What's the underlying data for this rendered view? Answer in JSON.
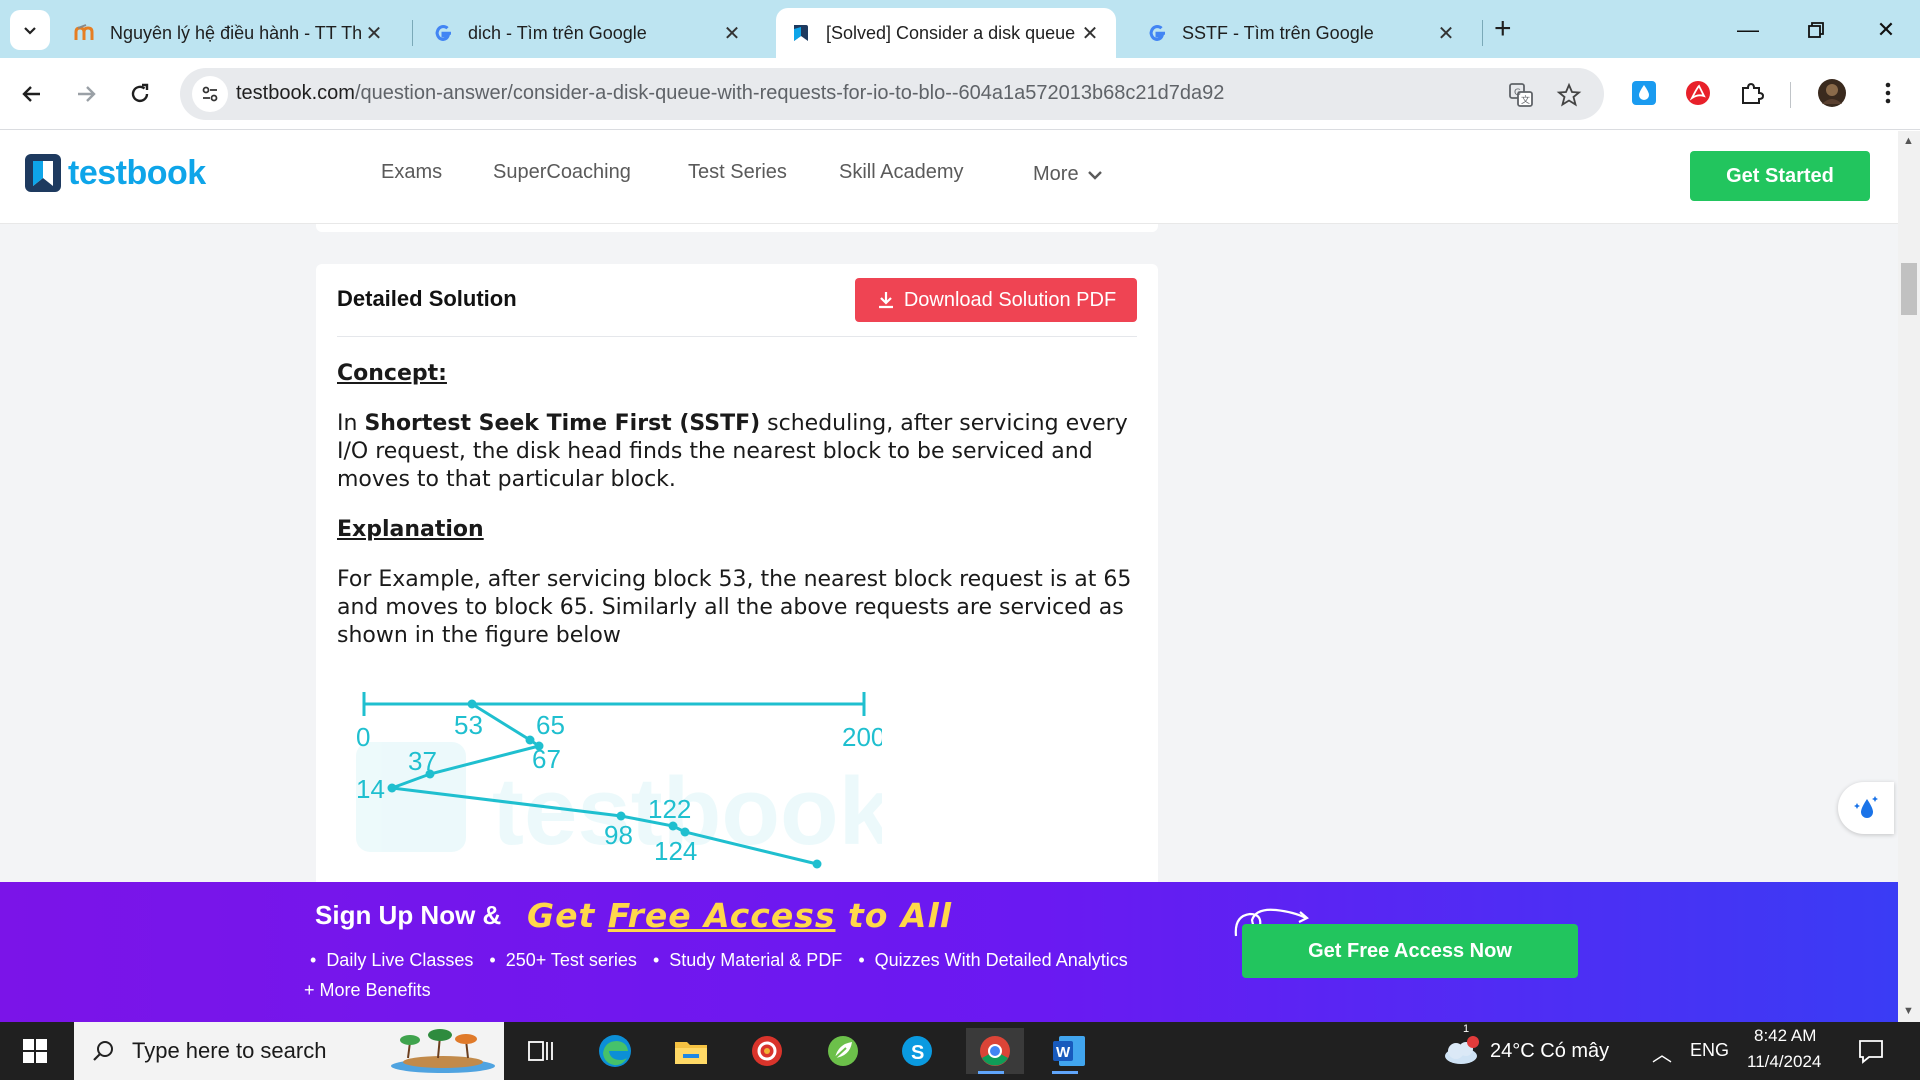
{
  "browser": {
    "tabs": [
      {
        "title": "Nguyên lý hệ điều hành - TT Th",
        "active": false
      },
      {
        "title": "dich - Tìm trên Google",
        "active": false
      },
      {
        "title": "[Solved] Consider a disk queue",
        "active": true
      },
      {
        "title": "SSTF - Tìm trên Google",
        "active": false
      }
    ],
    "url_domain": "testbook.com",
    "url_path": "/question-answer/consider-a-disk-queue-with-requests-for-io-to-blo--604a1a572013b68c21d7da92"
  },
  "header": {
    "logo_text": "testbook",
    "nav": [
      "Exams",
      "SuperCoaching",
      "Test Series",
      "Skill Academy",
      "More"
    ],
    "cta": "Get Started"
  },
  "solution": {
    "title": "Detailed Solution",
    "download_label": "Download Solution PDF",
    "concept_heading": "Concept:",
    "concept_pre": "In ",
    "concept_bold": "Shortest Seek Time First (SSTF)",
    "concept_post": " scheduling, after servicing every I/O request, the disk head finds the nearest block to be serviced and moves to that particular block.",
    "explanation_heading": "Explanation",
    "explanation_text": "For Example, after servicing block 53, the nearest block request is at 65 and moves to block 65. Similarly all the above requests are serviced as shown in the figure below"
  },
  "figure": {
    "axis_start": "0",
    "axis_end": "200",
    "points": [
      {
        "label": "53"
      },
      {
        "label": "65"
      },
      {
        "label": "67"
      },
      {
        "label": "37"
      },
      {
        "label": "14"
      },
      {
        "label": "98"
      },
      {
        "label": "122"
      },
      {
        "label": "124"
      }
    ],
    "watermark": "testbook",
    "color": "#1fbfcf"
  },
  "promo": {
    "headline": "Sign Up Now &",
    "accent_pre": "Get ",
    "accent_free": "Free Access",
    "accent_post": " to All",
    "benefits": [
      "Daily Live Classes",
      "250+ Test series",
      "Study Material & PDF",
      "Quizzes With Detailed Analytics"
    ],
    "more": "+ More Benefits",
    "cta": "Get Free Access Now"
  },
  "taskbar": {
    "search_placeholder": "Type here to search",
    "weather": "24°C  Có mây",
    "weather_badge": "1",
    "language": "ENG",
    "time": "8:42 AM",
    "date": "11/4/2024"
  },
  "colors": {
    "brand_blue": "#0ea5e9",
    "cta_green": "#22c55e",
    "download_red": "#ef4453",
    "promo_purple": "#7b14e8"
  }
}
